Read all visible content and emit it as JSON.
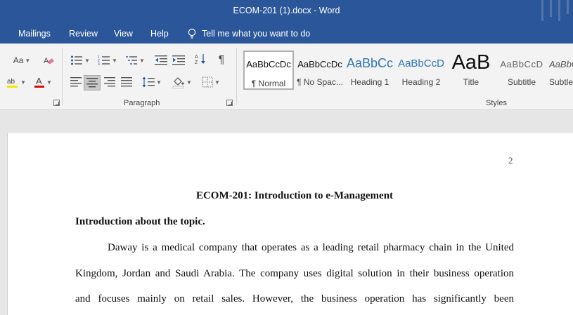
{
  "window": {
    "title": "ECOM-201 (1).docx  -  Word"
  },
  "tabs": [
    "Mailings",
    "Review",
    "View",
    "Help"
  ],
  "tell_me": {
    "placeholder": "Tell me what you want to do",
    "icon": "lightbulb-icon"
  },
  "ribbon": {
    "font_group": {
      "change_case": "Aa"
    },
    "paragraph_group": {
      "label": "Paragraph"
    },
    "styles_group": {
      "label": "Styles",
      "items": [
        {
          "sample": "AaBbCcDc",
          "name": "¶ Normal",
          "active": true
        },
        {
          "sample": "AaBbCcDc",
          "name": "¶ No Spac..."
        },
        {
          "sample": "AaBbCc",
          "name": "Heading 1"
        },
        {
          "sample": "AaBbCcD",
          "name": "Heading 2"
        },
        {
          "sample": "AaB",
          "name": "Title"
        },
        {
          "sample": "AaBbCcD",
          "name": "Subtitle"
        },
        {
          "sample": "AaBbCcL",
          "name": "Subtle"
        }
      ]
    }
  },
  "document": {
    "page_number": "2",
    "title": "ECOM-201: Introduction to e-Management",
    "heading": "Introduction about the topic.",
    "lines": [
      "Daway is a medical company that operates as a leading retail pharmacy chain in the United",
      "Kingdom, Jordan and Saudi Arabia. The company uses digital solution in their business operation",
      "and focuses mainly on retail sales. However, the business operation has significantly been"
    ]
  },
  "colors": {
    "word_blue": "#2b579a",
    "ribbon_bg": "#f3f3f3",
    "canvas_bg": "#e6e6e6"
  }
}
